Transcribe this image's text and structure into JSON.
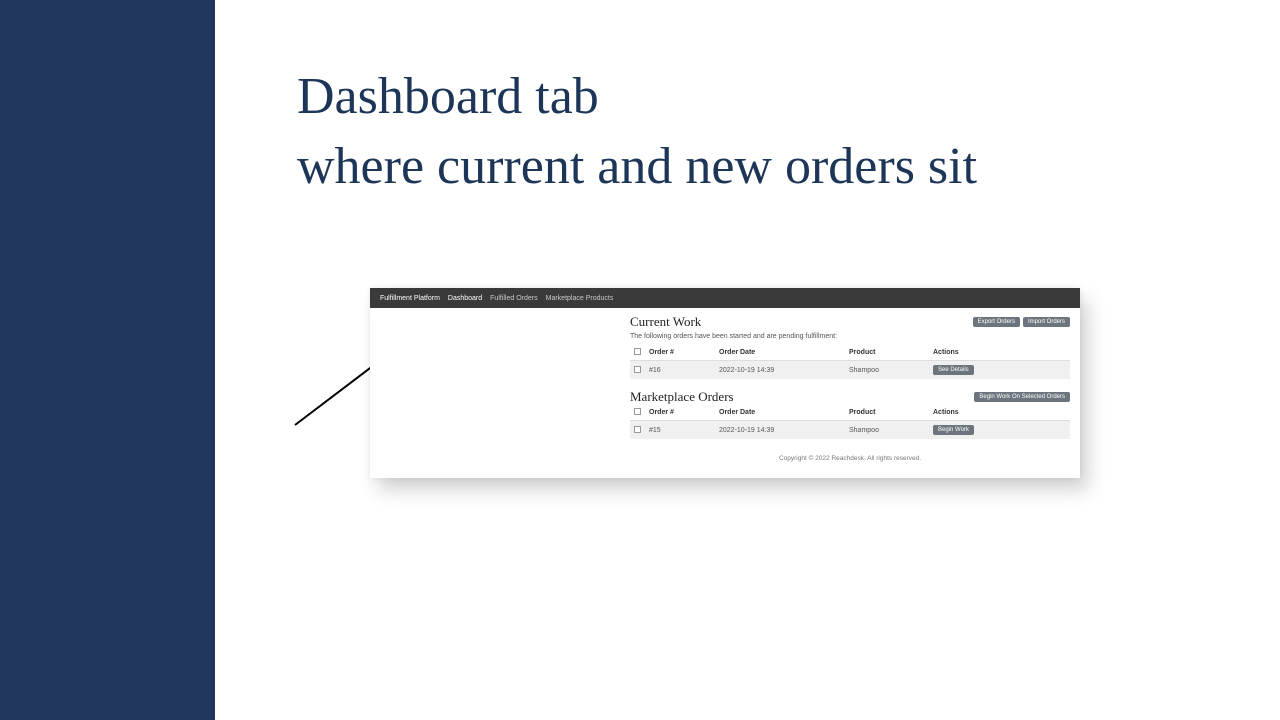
{
  "slide": {
    "title_line1": "Dashboard tab",
    "title_line2": "where current and new orders sit"
  },
  "nav": {
    "brand": "Fulfillment Platform",
    "links": [
      {
        "label": "Dashboard",
        "active": true
      },
      {
        "label": "Fulfilled Orders",
        "active": false
      },
      {
        "label": "Marketplace Products",
        "active": false
      }
    ]
  },
  "current_work": {
    "title": "Current Work",
    "subtitle": "The following orders have been started and are pending fulfillment:",
    "export_btn": "Export Orders",
    "import_btn": "Import Orders",
    "columns": {
      "order": "Order #",
      "date": "Order Date",
      "product": "Product",
      "actions": "Actions"
    },
    "rows": [
      {
        "order": "#16",
        "date": "2022-10-19 14:39",
        "product": "Shampoo",
        "action": "See Details"
      }
    ]
  },
  "marketplace": {
    "title": "Marketplace Orders",
    "begin_selected_btn": "Begin Work On Selected Orders",
    "columns": {
      "order": "Order #",
      "date": "Order Date",
      "product": "Product",
      "actions": "Actions"
    },
    "rows": [
      {
        "order": "#15",
        "date": "2022-10-19 14:39",
        "product": "Shampoo",
        "action": "Begin Work"
      }
    ]
  },
  "footer": "Copyright © 2022 Reachdesk. All rights reserved."
}
